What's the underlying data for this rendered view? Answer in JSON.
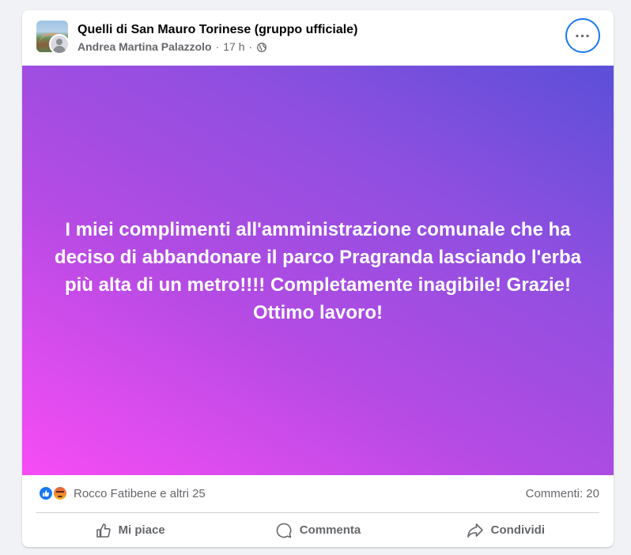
{
  "post": {
    "group_name": "Quelli di San Mauro Torinese (gruppo ufficiale)",
    "author": "Andrea Martina Palazzolo",
    "separator": "·",
    "time": "17 h",
    "privacy_icon": "globe-icon",
    "text": "I miei complimenti all'amministrazione comunale che ha deciso di abbandonare il parco Pragranda lasciando l'erba più alta di un metro!!!! Completamente inagibile! Grazie! Ottimo lavoro!",
    "background_colors": [
      "#f74cf5",
      "#b24be3",
      "#5b4fd8"
    ]
  },
  "reactions": {
    "icons": [
      "like-icon",
      "angry-icon"
    ],
    "summary": "Rocco Fatibene e altri 25",
    "comments": "Commenti: 20"
  },
  "actions": {
    "like": "Mi piace",
    "comment": "Commenta",
    "share": "Condividi"
  },
  "colors": {
    "accent": "#1877f2",
    "secondary_text": "#65676b"
  }
}
